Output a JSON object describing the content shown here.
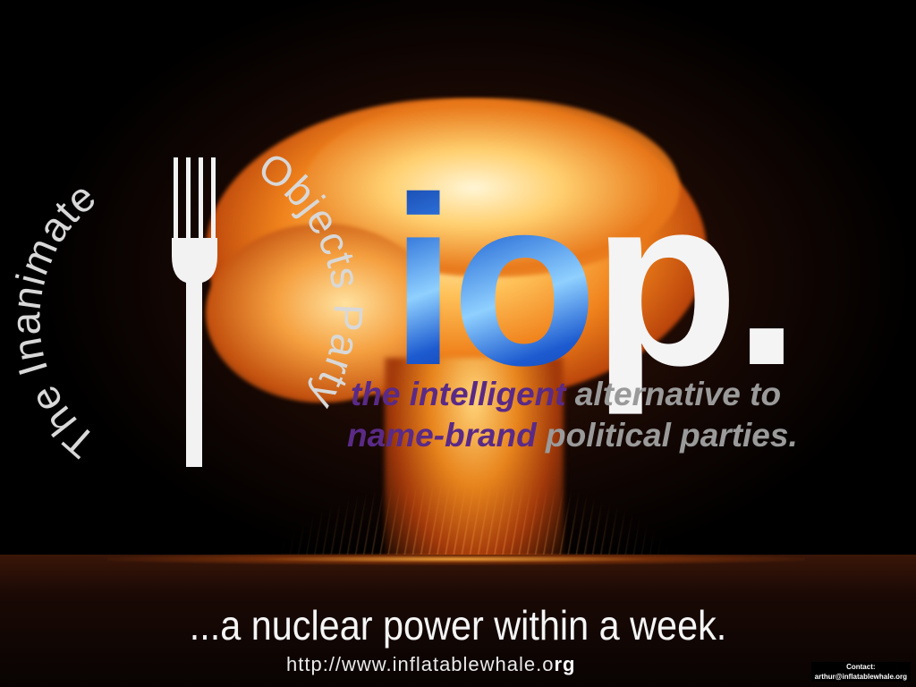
{
  "brand": {
    "party_name_part1": "The Inanimate",
    "party_name_part2": "Objects Party",
    "logo_letters": {
      "i": "i",
      "o": "o",
      "p": "p",
      "dot": "."
    },
    "fork_icon": "fork-icon"
  },
  "tagline": {
    "line1_a": "the intelligent",
    "line1_b": " alternative to",
    "line2_a": "name-brand",
    "line2_b": " political parties."
  },
  "slogan": "...a nuclear power within a week.",
  "url": {
    "main": "http://www.inflatablewhale.o",
    "tail": "rg"
  },
  "contact": {
    "label": "Contact:",
    "email": "arthur@inflatablewhale.org"
  },
  "colors": {
    "background": "#000000",
    "logo_blue": "#2b6fd8",
    "logo_white": "#f4f4f4",
    "tagline_gray": "#9a9a9a",
    "tagline_purple": "#5a2a86"
  }
}
